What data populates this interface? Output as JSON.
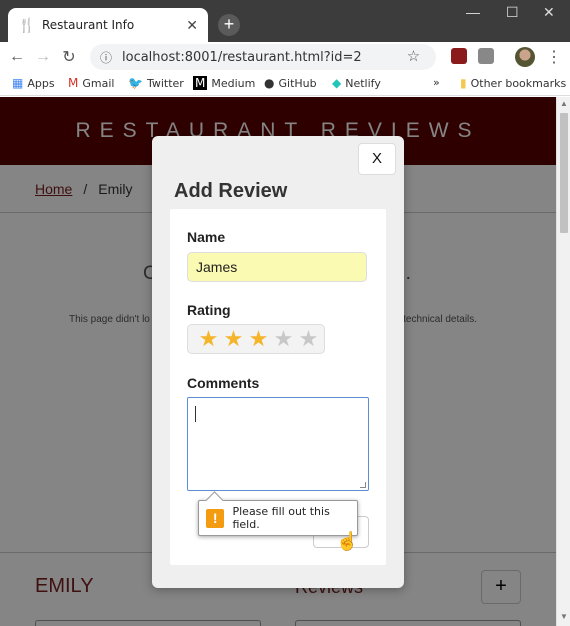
{
  "browser": {
    "tab_title": "Restaurant Info",
    "tab_close": "✕",
    "new_tab": "+",
    "url": "localhost:8001/restaurant.html?id=2",
    "minimize": "—",
    "maximize": "☐",
    "close": "✕"
  },
  "bookmarks": {
    "apps": "Apps",
    "gmail": "Gmail",
    "twitter": "Twitter",
    "medium": "Medium",
    "github": "GitHub",
    "netlify": "Netlify",
    "more": "»",
    "other": "Other bookmarks"
  },
  "page": {
    "header_title": "RESTAURANT REVIEWS",
    "breadcrumb_home": "Home",
    "breadcrumb_sep": "/",
    "breadcrumb_current": "Emily",
    "error_title_left": "C",
    "error_title_right": "g.",
    "error_sub_left": "This page didn't lo",
    "error_sub_right": "r technical details.",
    "restaurant_name": "EMILY",
    "reviews_heading": "Reviews",
    "add_review_button": "+"
  },
  "modal": {
    "close_label": "X",
    "title": "Add Review",
    "name_label": "Name",
    "name_value": "James",
    "rating_label": "Rating",
    "rating_value": 3,
    "rating_max": 5,
    "comments_label": "Comments",
    "comments_value": ""
  },
  "tooltip": {
    "icon": "!",
    "text": "Please fill out this field."
  },
  "colors": {
    "header_bg": "#5a0000",
    "accent": "#7a1f1f",
    "star_on": "#f5b52a",
    "star_off": "#c8c8c8",
    "name_input_bg": "#fafab2",
    "warning": "#f39c12"
  }
}
